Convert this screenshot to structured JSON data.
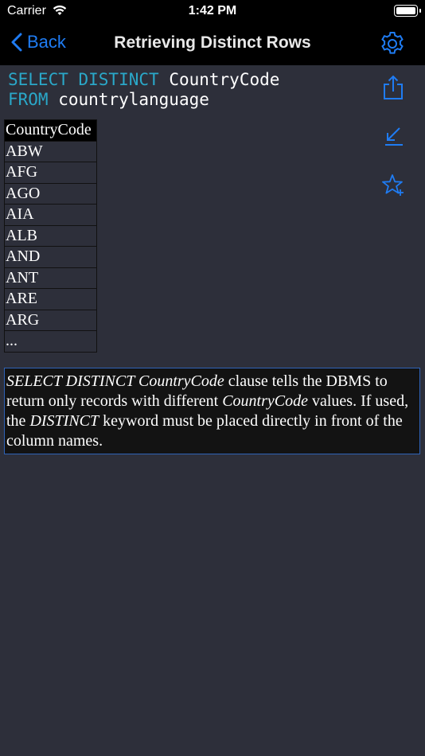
{
  "status": {
    "carrier": "Carrier",
    "time": "1:42 PM"
  },
  "nav": {
    "back_label": "Back",
    "title": "Retrieving Distinct Rows"
  },
  "sql": {
    "line1_kw": "SELECT DISTINCT",
    "line1_id": "CountryCode",
    "line2_kw": "FROM",
    "line2_id": "countrylanguage"
  },
  "table": {
    "header": "CountryCode",
    "rows": [
      "ABW",
      "AFG",
      "AGO",
      "AIA",
      "ALB",
      "AND",
      "ANT",
      "ARE",
      "ARG",
      "..."
    ]
  },
  "explanation": {
    "p1": "SELECT DISTINCT CountryCode",
    "p2": " clause tells the DBMS to return only records with different ",
    "p3": "CountryCode",
    "p4": " values. If used, the ",
    "p5": "DISTINCT",
    "p6": " keyword must be placed directly in front of the column names."
  },
  "icons": {
    "share": "share-icon",
    "collapse": "arrow-down-left-icon",
    "favorite": "star-plus-icon",
    "settings": "gear-icon"
  },
  "colors": {
    "accent": "#1f7cf3",
    "keyword": "#2aa8c9",
    "background": "#2d2f3a"
  }
}
